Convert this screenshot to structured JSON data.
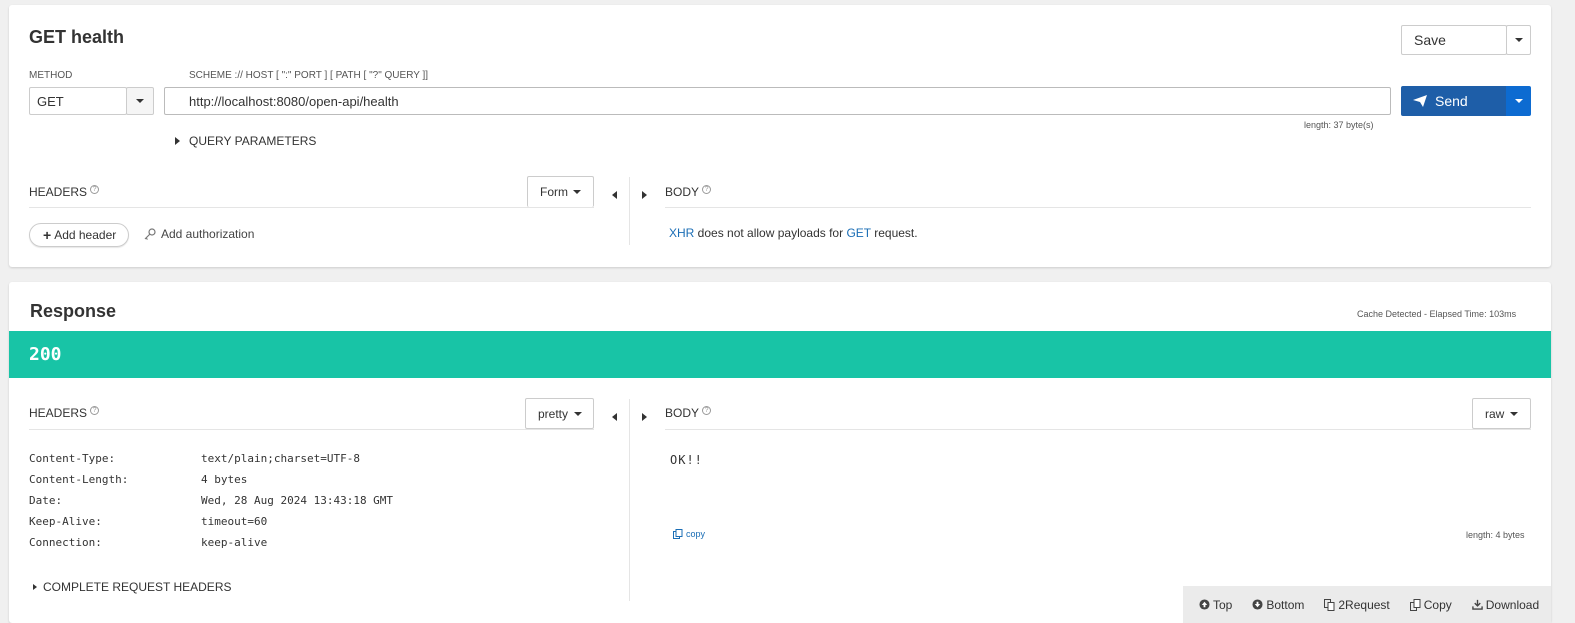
{
  "request": {
    "title": "GET health",
    "save_label": "Save",
    "method_label": "METHOD",
    "method_value": "GET",
    "url_label": "SCHEME :// HOST [ \":\" PORT ] [ PATH [ \"?\" QUERY ]]",
    "url_value": "http://localhost:8080/open-api/health",
    "url_length": "length: 37 byte(s)",
    "send_label": "Send",
    "query_params_label": "QUERY PARAMETERS",
    "headers_label": "HEADERS",
    "form_label": "Form",
    "body_label": "BODY",
    "add_header_label": "Add header",
    "add_auth_label": "Add authorization",
    "body_msg_xhr": "XHR",
    "body_msg_mid": " does not allow payloads for ",
    "body_msg_get": "GET",
    "body_msg_end": " request."
  },
  "response": {
    "title": "Response",
    "cache_info": "Cache Detected - Elapsed Time: 103ms",
    "status_code": "200",
    "status_color": "#18c4a6",
    "headers_label": "HEADERS",
    "pretty_label": "pretty",
    "body_label": "BODY",
    "raw_label": "raw",
    "headers": [
      {
        "name": "Content-Type:",
        "value": "text/plain;charset=UTF-8"
      },
      {
        "name": "Content-Length:",
        "value": "4 bytes"
      },
      {
        "name": "Date:",
        "value": "Wed, 28 Aug 2024 13:43:18 GMT"
      },
      {
        "name": "Keep-Alive:",
        "value": "timeout=60"
      },
      {
        "name": "Connection:",
        "value": "keep-alive"
      }
    ],
    "body_text": "OK!!",
    "copy_label": "copy",
    "body_length": "length: 4 bytes",
    "complete_headers_label": "COMPLETE REQUEST HEADERS"
  },
  "footer": {
    "top": "Top",
    "bottom": "Bottom",
    "to_request": "2Request",
    "copy": "Copy",
    "download": "Download"
  },
  "colors": {
    "send_blue": "#1e5ea8",
    "send_caret_blue": "#0d6bd1",
    "link_blue": "#1a6db5",
    "status_green": "#18c4a6"
  }
}
